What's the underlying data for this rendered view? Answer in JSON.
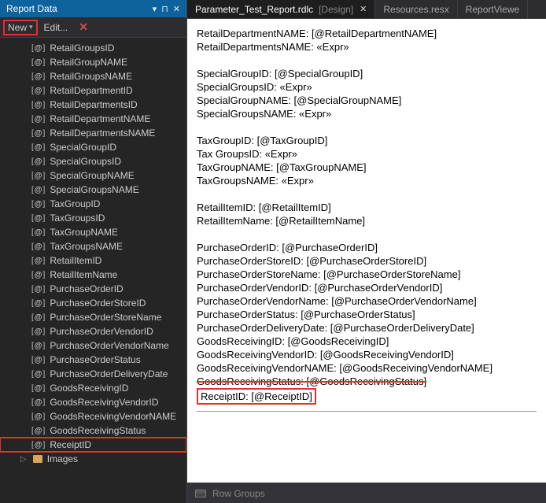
{
  "panel": {
    "title": "Report Data",
    "new_label": "New",
    "edit_label": "Edit..."
  },
  "parameters": [
    "RetailGroupsID",
    "RetailGroupNAME",
    "RetailGroupsNAME",
    "RetailDepartmentID",
    "RetailDepartmentsID",
    "RetailDepartmentNAME",
    "RetailDepartmentsNAME",
    "SpecialGroupID",
    "SpecialGroupsID",
    "SpecialGroupNAME",
    "SpecialGroupsNAME",
    "TaxGroupID",
    "TaxGroupsID",
    "TaxGroupNAME",
    "TaxGroupsNAME",
    "RetailItemID",
    "RetailItemName",
    "PurchaseOrderID",
    "PurchaseOrderStoreID",
    "PurchaseOrderStoreName",
    "PurchaseOrderVendorID",
    "PurchaseOrderVendorName",
    "PurchaseOrderStatus",
    "PurchaseOrderDeliveryDate",
    "GoodsReceivingID",
    "GoodsReceivingVendorID",
    "GoodsReceivingVendorNAME",
    "GoodsReceivingStatus",
    "ReceiptID"
  ],
  "highlighted_parameter": "ReceiptID",
  "images_label": "Images",
  "tabs": [
    {
      "label": "Parameter_Test_Report.rdlc",
      "suffix": "[Design]",
      "active": true,
      "closable": true
    },
    {
      "label": "Resources.resx",
      "active": false,
      "closable": false
    },
    {
      "label": "ReportViewe",
      "active": false,
      "closable": false
    }
  ],
  "report_body": [
    "RetailDepartmentNAME: [@RetailDepartmentNAME]",
    "RetailDepartmentsNAME: «Expr»",
    "",
    "SpecialGroupID: [@SpecialGroupID]",
    "SpecialGroupsID: «Expr»",
    "SpecialGroupNAME: [@SpecialGroupNAME]",
    "SpecialGroupsNAME: «Expr»",
    "",
    "TaxGroupID: [@TaxGroupID]",
    "Tax GroupsID: «Expr»",
    "TaxGroupNAME: [@TaxGroupNAME]",
    "TaxGroupsNAME: «Expr»",
    "",
    "RetailItemID: [@RetailItemID]",
    "RetailItemName: [@RetailItemName]",
    "",
    "PurchaseOrderID: [@PurchaseOrderID]",
    "PurchaseOrderStoreID: [@PurchaseOrderStoreID]",
    "PurchaseOrderStoreName: [@PurchaseOrderStoreName]",
    "PurchaseOrderVendorID: [@PurchaseOrderVendorID]",
    "PurchaseOrderVendorName: [@PurchaseOrderVendorName]",
    "PurchaseOrderStatus: [@PurchaseOrderStatus]",
    "PurchaseOrderDeliveryDate: [@PurchaseOrderDeliveryDate]",
    "GoodsReceivingID: [@GoodsReceivingID]",
    "GoodsReceivingVendorID: [@GoodsReceivingVendorID]",
    "GoodsReceivingVendorNAME: [@GoodsReceivingVendorNAME]"
  ],
  "strike_line": "GoodsReceivingStatus: [@GoodsReceivingStatus]",
  "boxed_line": "ReceiptID: [@ReceiptID]",
  "row_groups_label": "Row Groups"
}
